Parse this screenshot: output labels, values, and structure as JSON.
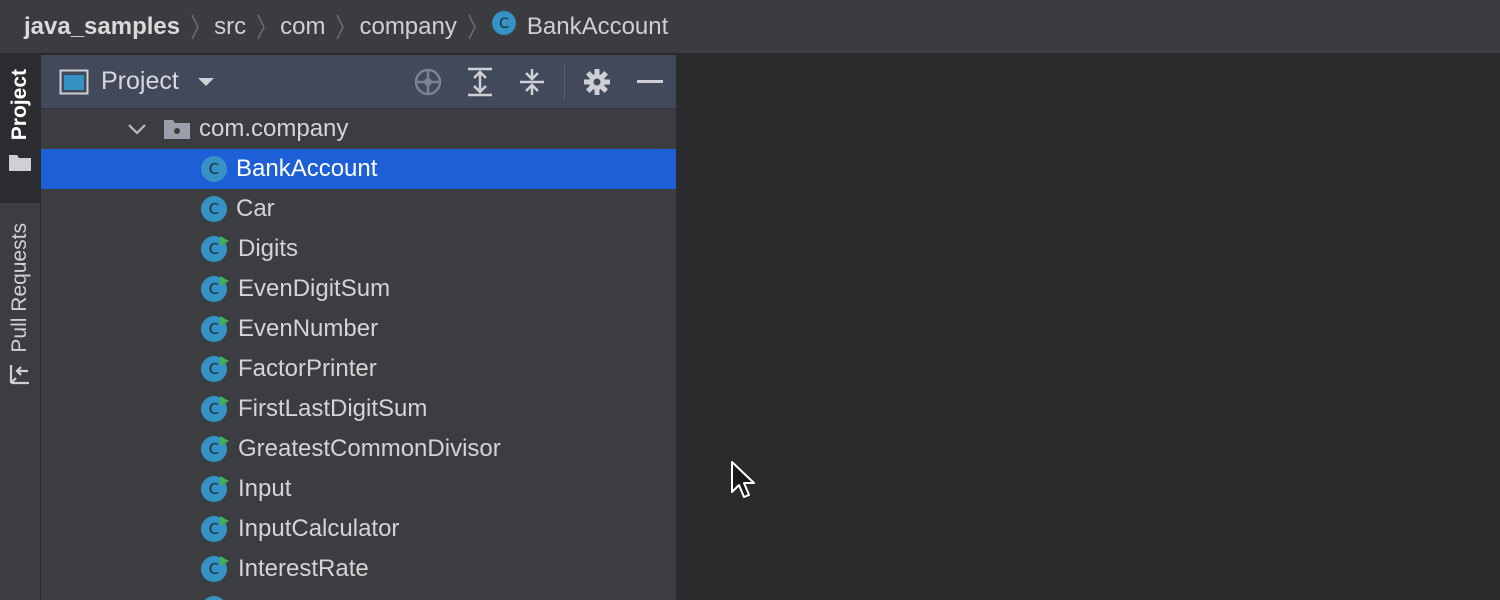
{
  "navbar": {
    "crumbs": [
      {
        "label": "java_samples",
        "icon": "none"
      },
      {
        "label": "src",
        "icon": "none"
      },
      {
        "label": "com",
        "icon": "none"
      },
      {
        "label": "company",
        "icon": "none"
      },
      {
        "label": "BankAccount",
        "icon": "java-class-icon"
      }
    ]
  },
  "stripe": {
    "project_label": "Project",
    "pull_requests_label": "Pull Requests"
  },
  "project_panel": {
    "title": "Project",
    "toolbar_icons": [
      "panel-view-icon",
      "chevron-down-icon",
      "locate-icon",
      "expand-all-icon",
      "collapse-all-icon",
      "gear-icon",
      "minimize-icon"
    ]
  },
  "tree": {
    "package": {
      "label": "com.company",
      "icon": "package-folder-icon",
      "expanded": true
    },
    "items": [
      {
        "label": "BankAccount",
        "icon": "java-class-icon",
        "selected": true
      },
      {
        "label": "Car",
        "icon": "java-class-icon"
      },
      {
        "label": "Digits",
        "icon": "java-class-runnable-icon"
      },
      {
        "label": "EvenDigitSum",
        "icon": "java-class-runnable-icon"
      },
      {
        "label": "EvenNumber",
        "icon": "java-class-runnable-icon"
      },
      {
        "label": "FactorPrinter",
        "icon": "java-class-runnable-icon"
      },
      {
        "label": "FirstLastDigitSum",
        "icon": "java-class-runnable-icon"
      },
      {
        "label": "GreatestCommonDivisor",
        "icon": "java-class-runnable-icon"
      },
      {
        "label": "Input",
        "icon": "java-class-runnable-icon"
      },
      {
        "label": "InputCalculator",
        "icon": "java-class-runnable-icon"
      },
      {
        "label": "InterestRate",
        "icon": "java-class-runnable-icon"
      }
    ]
  },
  "colors": {
    "selection": "#1d5fd6",
    "class_icon": "#3592c4",
    "run_marker": "#3fb34f"
  }
}
